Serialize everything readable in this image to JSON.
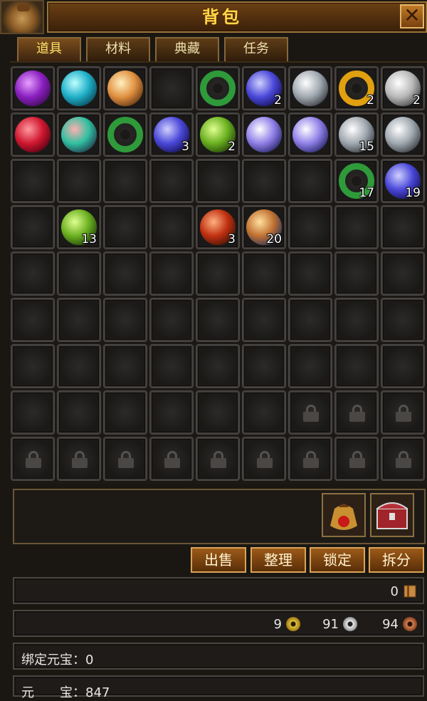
{
  "header": {
    "title": "背包",
    "close_label": "✕"
  },
  "tabs": [
    {
      "label": "道具",
      "active": true
    },
    {
      "label": "材料",
      "active": false
    },
    {
      "label": "典藏",
      "active": false
    },
    {
      "label": "任务",
      "active": false
    }
  ],
  "grid": {
    "columns": 9,
    "rows": 9,
    "items": [
      {
        "slot": 0,
        "name": "purple-crystal-ball-icon",
        "colors": [
          "#e8a0ff",
          "#8a1fc0",
          "#3a0a50"
        ],
        "count": ""
      },
      {
        "slot": 1,
        "name": "cyan-crystal-ball-icon",
        "colors": [
          "#c0ffff",
          "#1fb0c8",
          "#0a4050"
        ],
        "count": ""
      },
      {
        "slot": 2,
        "name": "amber-crystal-ball-icon",
        "colors": [
          "#fff0c0",
          "#e09040",
          "#5a3010"
        ],
        "count": ""
      },
      {
        "slot": 4,
        "name": "jade-ring-icon",
        "colors": [
          "#b0f0a0",
          "#2f9a3a",
          "#0e3a14"
        ],
        "count": ""
      },
      {
        "slot": 5,
        "name": "blue-ore-icon",
        "colors": [
          "#d0d0ff",
          "#4a48d8",
          "#120e50"
        ],
        "count": "2"
      },
      {
        "slot": 6,
        "name": "diamond-icon",
        "colors": [
          "#ffffff",
          "#a0a8b0",
          "#303438"
        ],
        "count": ""
      },
      {
        "slot": 7,
        "name": "gold-ring-icon",
        "colors": [
          "#fff0a0",
          "#e0a010",
          "#6a4000"
        ],
        "count": "2"
      },
      {
        "slot": 8,
        "name": "white-diamond-icon",
        "colors": [
          "#ffffff",
          "#b8b8b8",
          "#404040"
        ],
        "count": "2"
      },
      {
        "slot": 9,
        "name": "ruby-icon",
        "colors": [
          "#ff9aa0",
          "#d01830",
          "#500010"
        ],
        "count": ""
      },
      {
        "slot": 10,
        "name": "mixed-crystal-icon",
        "colors": [
          "#ffb0b0",
          "#30c0a0",
          "#20304a"
        ],
        "count": ""
      },
      {
        "slot": 11,
        "name": "jade-ring-icon",
        "colors": [
          "#b0f0a0",
          "#2f9a3a",
          "#0e3a14"
        ],
        "count": ""
      },
      {
        "slot": 12,
        "name": "blue-ore-icon",
        "colors": [
          "#d0d0ff",
          "#4a48d8",
          "#120e50"
        ],
        "count": "3"
      },
      {
        "slot": 13,
        "name": "green-disc-icon",
        "colors": [
          "#e0ff90",
          "#6ab020",
          "#1e3a08"
        ],
        "count": "2"
      },
      {
        "slot": 14,
        "name": "moon-crystal-icon",
        "colors": [
          "#ffffff",
          "#9080e8",
          "#202060"
        ],
        "count": ""
      },
      {
        "slot": 15,
        "name": "moon-crystal-icon",
        "colors": [
          "#ffffff",
          "#9080e8",
          "#202060"
        ],
        "count": ""
      },
      {
        "slot": 16,
        "name": "diamond-icon",
        "colors": [
          "#ffffff",
          "#a0a8b0",
          "#303438"
        ],
        "count": "15"
      },
      {
        "slot": 17,
        "name": "diamond-icon",
        "colors": [
          "#ffffff",
          "#a0a8b0",
          "#303438"
        ],
        "count": ""
      },
      {
        "slot": 25,
        "name": "jade-ring-icon",
        "colors": [
          "#b0f0a0",
          "#2f9a3a",
          "#0e3a14"
        ],
        "count": "17"
      },
      {
        "slot": 26,
        "name": "blue-ore-icon",
        "colors": [
          "#d0d0ff",
          "#4a48d8",
          "#120e50"
        ],
        "count": "19"
      },
      {
        "slot": 28,
        "name": "green-disc-icon",
        "colors": [
          "#e0ff90",
          "#6ab020",
          "#1e3a08"
        ],
        "count": "13"
      },
      {
        "slot": 31,
        "name": "red-scorpion-icon",
        "colors": [
          "#ffb080",
          "#c03010",
          "#3a1208"
        ],
        "count": "3"
      },
      {
        "slot": 32,
        "name": "talisman-scroll-icon",
        "colors": [
          "#ffe0a0",
          "#c07030",
          "#203060"
        ],
        "count": "20"
      }
    ],
    "locked_slots": [
      69,
      70,
      71,
      72,
      73,
      74,
      75,
      76,
      77,
      78,
      79,
      80
    ]
  },
  "feature_buttons": [
    {
      "name": "lucky-bag-icon"
    },
    {
      "name": "treasure-chest-icon"
    }
  ],
  "actions": {
    "sell": "出售",
    "sort": "整理",
    "lock": "锁定",
    "split": "拆分"
  },
  "capacity": {
    "value": "0"
  },
  "currency": {
    "gold": "9",
    "silver": "91",
    "copper": "94"
  },
  "bound_yuanbao": "绑定元宝：0",
  "yuanbao": "元　　宝：847"
}
